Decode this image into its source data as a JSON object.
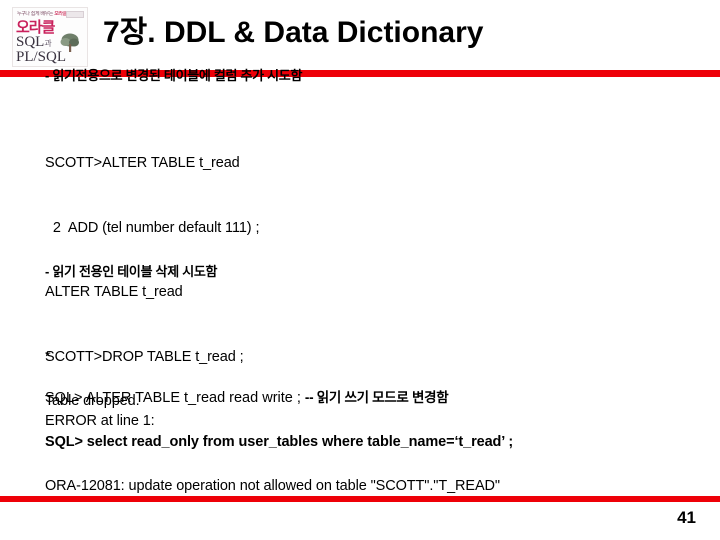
{
  "slide": {
    "title": "7장. DDL & Data Dictionary",
    "page_number": "41",
    "accent_color": "#ee0008"
  },
  "logo": {
    "alt": "오라클 SQL과 PL/SQL 책 표지",
    "top_line_plain": "누구나 쉽게 배우는",
    "top_line_highlight": "오라클",
    "korean_title": "오라클",
    "sql_line": "SQL",
    "sql_sub": "과",
    "plsql_line": "PL/SQL"
  },
  "bar_heading": {
    "text": "- 읽기전용으로 변경된 테이블에 컬럼 추가 시도함"
  },
  "sections": {
    "drop_heading": "- 읽기 전용인 테이블 삭제 시도함"
  },
  "code": {
    "alter_block": [
      "SCOTT>ALTER TABLE t_read",
      "  2  ADD (tel number default 111) ;",
      "ALTER TABLE t_read",
      "*",
      "ERROR at line 1:",
      "ORA-12081: update operation not allowed on table \"SCOTT\".\"T_READ\""
    ],
    "drop_block": [
      "SCOTT>DROP TABLE t_read ;"
    ],
    "dropped_block": [
      "Table dropped."
    ]
  },
  "sql_statements": {
    "read_write": {
      "sql": "SQL> ALTER TABLE  t_read   read  write ; ",
      "comment": "-- 읽기 쓰기 모드로 변경함"
    },
    "select_read_only": {
      "sql": "SQL> select read_only from user_tables where table_name=‘t_read’ ;"
    }
  }
}
